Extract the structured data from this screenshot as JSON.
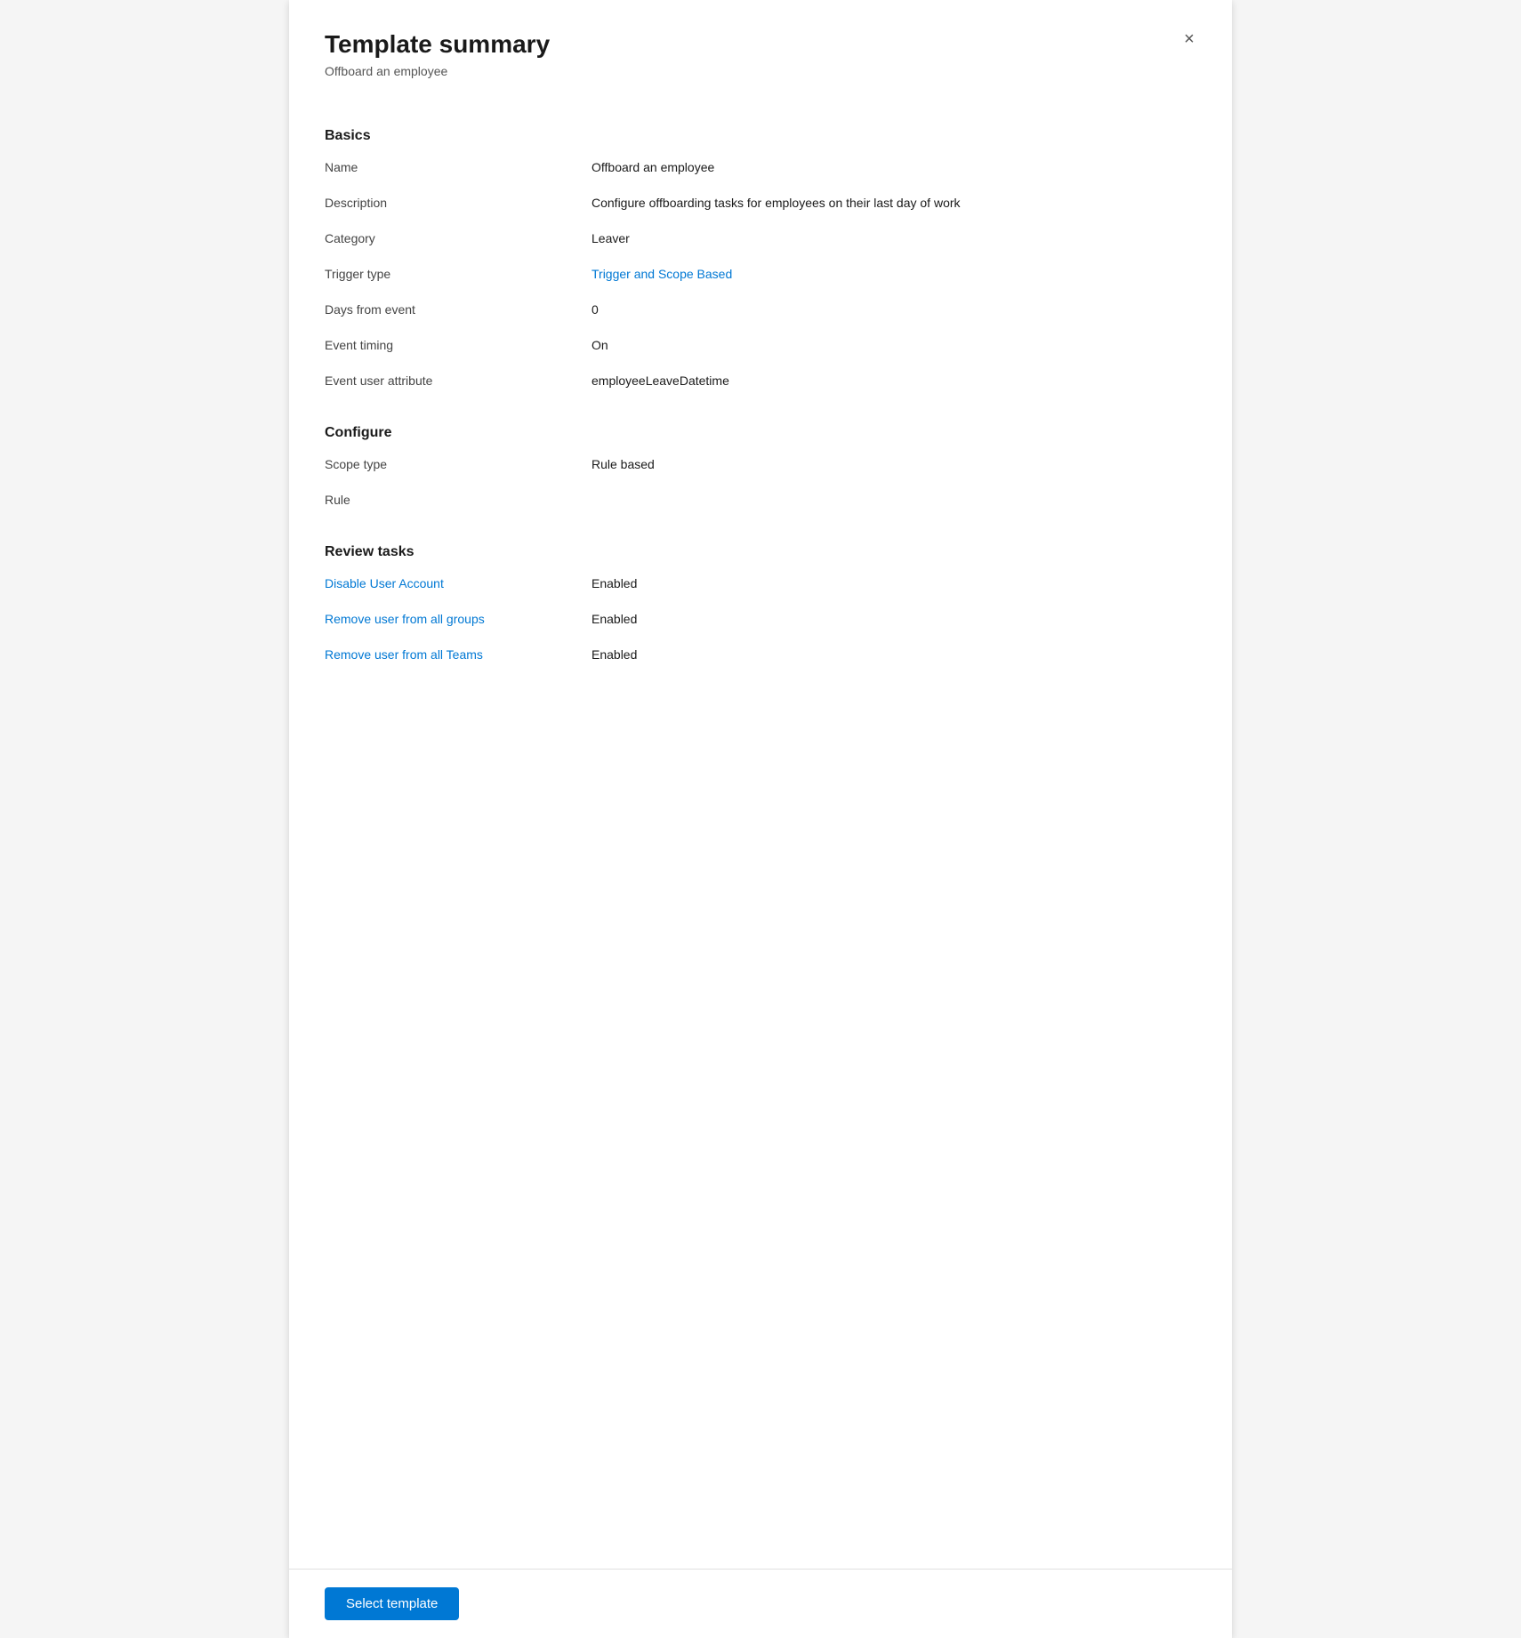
{
  "panel": {
    "title": "Template summary",
    "subtitle": "Offboard an employee",
    "close_label": "×"
  },
  "sections": [
    {
      "id": "basics",
      "heading": "Basics",
      "fields": [
        {
          "label": "Name",
          "value": "Offboard an employee",
          "link": false
        },
        {
          "label": "Description",
          "value": "Configure offboarding tasks for employees on their last day of work",
          "link": false
        },
        {
          "label": "Category",
          "value": "Leaver",
          "link": false
        },
        {
          "label": "Trigger type",
          "value": "Trigger and Scope Based",
          "link": true
        },
        {
          "label": "Days from event",
          "value": "0",
          "link": false
        },
        {
          "label": "Event timing",
          "value": "On",
          "link": false
        },
        {
          "label": "Event user attribute",
          "value": "employeeLeaveDatetime",
          "link": false
        }
      ]
    },
    {
      "id": "configure",
      "heading": "Configure",
      "fields": [
        {
          "label": "Scope type",
          "value": "Rule based",
          "link": false
        },
        {
          "label": "Rule",
          "value": "",
          "link": false
        }
      ]
    },
    {
      "id": "review-tasks",
      "heading": "Review tasks",
      "fields": [
        {
          "label": "Disable User Account",
          "value": "Enabled",
          "link": true
        },
        {
          "label": "Remove user from all groups",
          "value": "Enabled",
          "link": true
        },
        {
          "label": "Remove user from all Teams",
          "value": "Enabled",
          "link": true
        }
      ]
    }
  ],
  "footer": {
    "select_template_label": "Select template"
  }
}
